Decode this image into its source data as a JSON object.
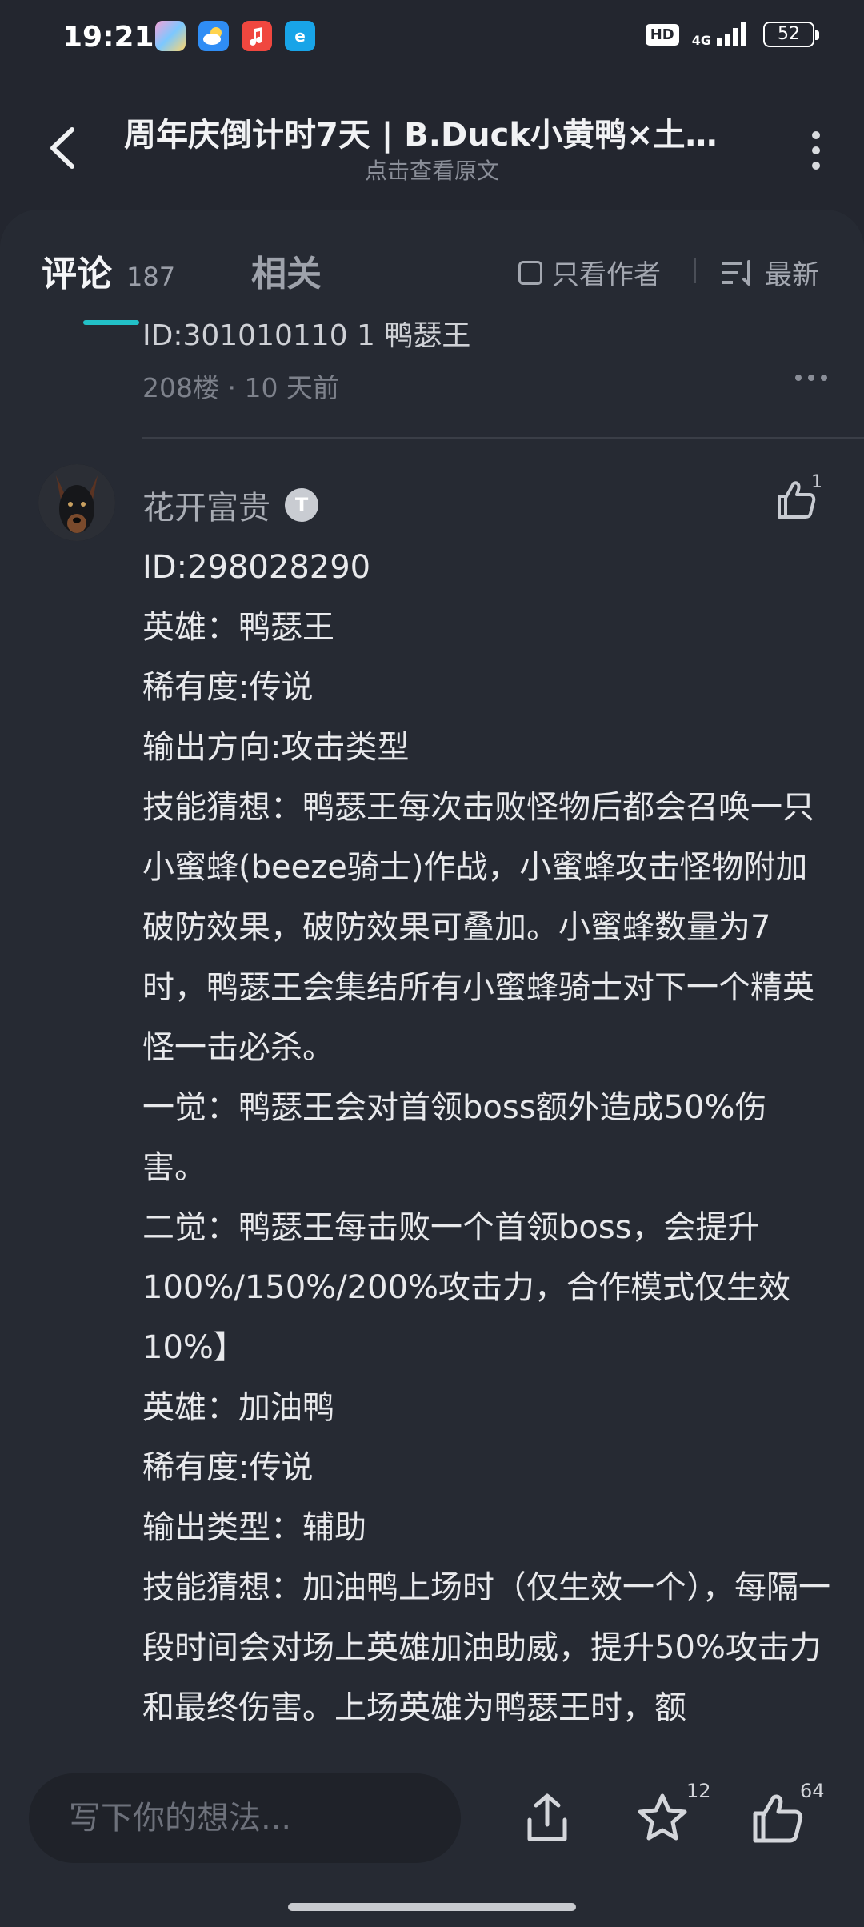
{
  "status_bar": {
    "time": "19:21",
    "hd": "HD",
    "network": "4G",
    "battery": "52"
  },
  "header": {
    "title": "周年庆倒计时7天 | B.Duck小黄鸭×土豆...",
    "subtitle": "点击查看原文"
  },
  "tabs": {
    "comments_label": "评论",
    "comments_count": "187",
    "related_label": "相关",
    "author_only_label": "只看作者",
    "sort_label": "最新"
  },
  "previous_comment": {
    "tail_text": "ID:301010110 1 鸭瑟王",
    "meta": "208楼 · 10 天前"
  },
  "comment": {
    "username": "花开富贵",
    "level": "T",
    "likes": "1",
    "lines": [
      "ID:298028290",
      "英雄：鸭瑟王",
      "稀有度:传说",
      "输出方向:攻击类型",
      "技能猜想：鸭瑟王每次击败怪物后都会召唤一只小蜜蜂(beeze骑士)作战，小蜜蜂攻击怪物附加破防效果，破防效果可叠加。小蜜蜂数量为7时，鸭瑟王会集结所有小蜜蜂骑士对下一个精英怪一击必杀。",
      "一觉：鸭瑟王会对首领boss额外造成50%伤害。",
      "二觉：鸭瑟王每击败一个首领boss，会提升100%/150%/200%攻击力，合作模式仅生效10%】",
      "英雄：加油鸭",
      "稀有度:传说",
      "输出类型：辅助",
      "技能猜想：加油鸭上场时（仅生效一个），每隔一段时间会对场上英雄加油助威，提升50%攻击力和最终伤害。上场英雄为鸭瑟王时，额"
    ]
  },
  "bottom_bar": {
    "input_placeholder": "写下你的想法...",
    "favorite_count": "12",
    "like_count": "64"
  },
  "colors": {
    "background": "#23262f",
    "panel": "#262a33",
    "accent": "#22c1c8"
  }
}
